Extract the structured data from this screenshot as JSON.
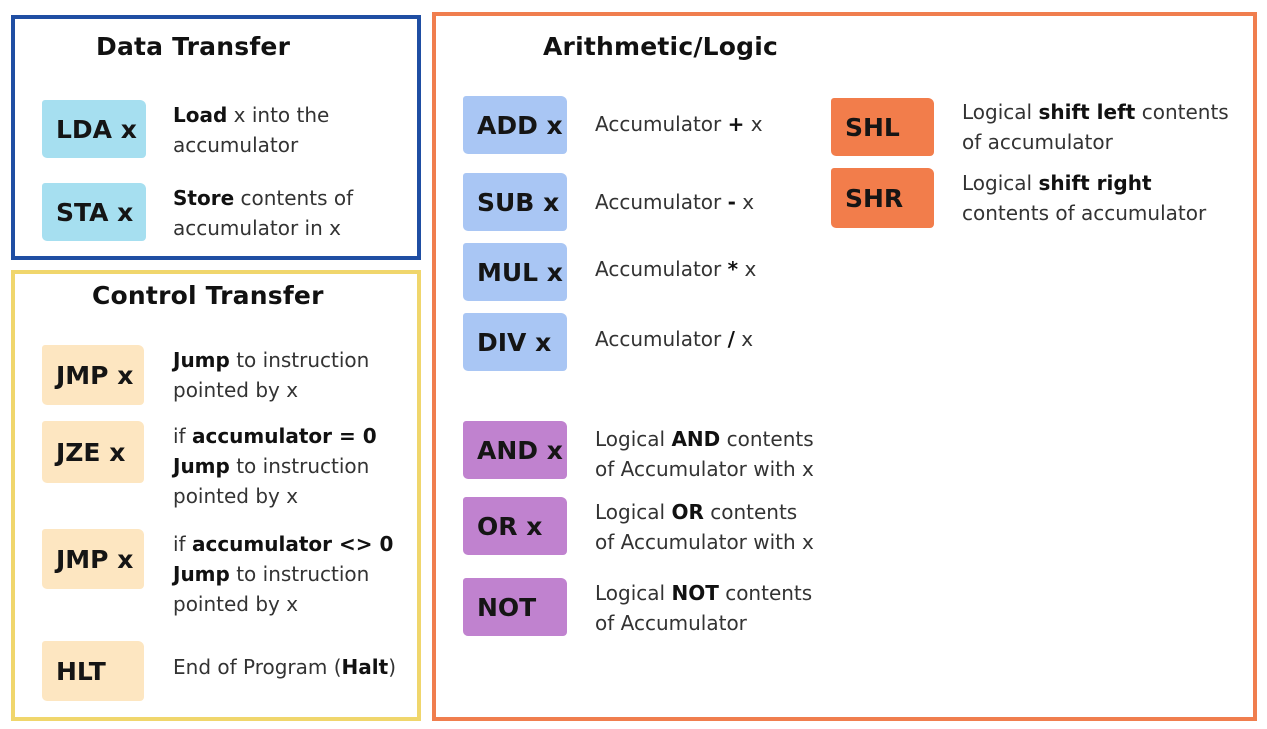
{
  "data_transfer": {
    "title": "Data Transfer",
    "items": [
      {
        "tag": "LDA x",
        "line1_bold": "Load",
        "line1_rest": " x into the",
        "line2": "accumulator"
      },
      {
        "tag": "STA x",
        "line1_bold": "Store",
        "line1_rest": " contents of",
        "line2": "accumulator in x"
      }
    ]
  },
  "control_transfer": {
    "title": "Control Transfer",
    "items": [
      {
        "tag": "JMP x",
        "line1_bold": "Jump",
        "line1_rest": " to instruction",
        "line2": "pointed by x"
      },
      {
        "tag": "JZE x",
        "cond_pre": "if ",
        "cond_bold": "accumulator = 0",
        "line1_bold": "Jump",
        "line1_rest": " to instruction",
        "line2": "pointed by x"
      },
      {
        "tag": "JMP x",
        "cond_pre": "if ",
        "cond_bold": "accumulator <> 0",
        "line1_bold": "Jump",
        "line1_rest": " to instruction",
        "line2": "pointed by x"
      },
      {
        "tag": "HLT",
        "pre": "End of Program (",
        "bold": "Halt",
        "post": ")"
      }
    ]
  },
  "arithmetic_logic": {
    "title": "Arithmetic/Logic",
    "arith": [
      {
        "tag": "ADD x",
        "pre": "Accumulator ",
        "op": "+",
        "post": " x"
      },
      {
        "tag": "SUB x",
        "pre": "Accumulator ",
        "op": "-",
        "post": " x"
      },
      {
        "tag": "MUL x",
        "pre": "Accumulator ",
        "op": "*",
        "post": " x"
      },
      {
        "tag": "DIV x",
        "pre": "Accumulator ",
        "op": "/",
        "post": " x"
      }
    ],
    "logic": [
      {
        "tag": "AND x",
        "pre": "Logical ",
        "bold": "AND",
        "post": " contents",
        "line2": "of Accumulator with x"
      },
      {
        "tag": "OR x",
        "pre": "Logical ",
        "bold": "OR",
        "post": " contents",
        "line2": "of Accumulator with x"
      },
      {
        "tag": "NOT",
        "pre": "Logical ",
        "bold": "NOT",
        "post": " contents",
        "line2": "of Accumulator"
      }
    ],
    "shift": [
      {
        "tag": "SHL",
        "pre": "Logical ",
        "bold": "shift left",
        "post": " contents",
        "line2": "of accumulator"
      },
      {
        "tag": "SHR",
        "pre": "Logical ",
        "bold": "shift right",
        "post": "",
        "line2": "contents of accumulator"
      }
    ]
  },
  "colors": {
    "data_transfer_border": "#1f4ea3",
    "control_transfer_border": "#f0d66c",
    "arithmetic_logic_border": "#f07e4e",
    "data_tag": "#a6dff0",
    "control_tag": "#fde6c1",
    "arith_tag": "#a9c6f4",
    "logic_tag": "#c082cf",
    "shift_tag": "#f27d4b"
  }
}
